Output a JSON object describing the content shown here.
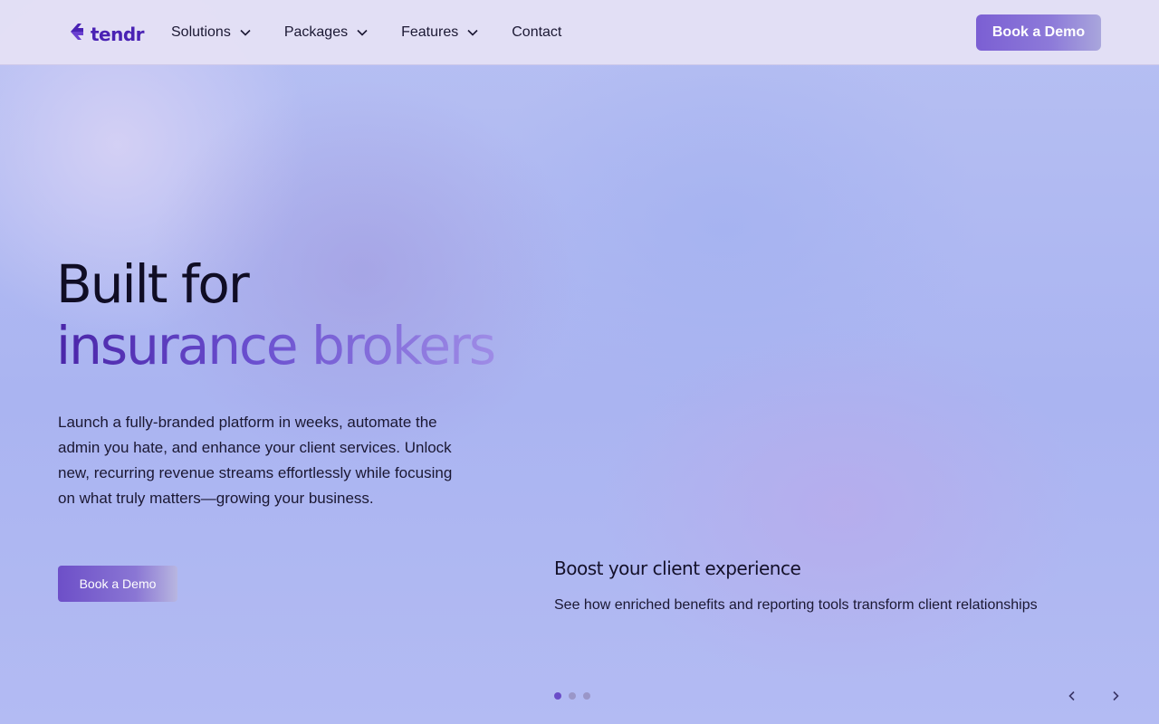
{
  "header": {
    "logo_text": "tendr",
    "nav": [
      {
        "label": "Solutions",
        "has_dropdown": true
      },
      {
        "label": "Packages",
        "has_dropdown": true
      },
      {
        "label": "Features",
        "has_dropdown": true
      },
      {
        "label": "Contact",
        "has_dropdown": false
      }
    ],
    "cta_label": "Book a Demo"
  },
  "hero": {
    "title_line1": "Built for",
    "title_line2": "insurance brokers",
    "description": "Launch a fully-branded platform in weeks, automate the admin you hate, and enhance your client services. Unlock new, recurring revenue streams effortlessly while focusing on what truly matters—growing your business.",
    "cta_label": "Book a Demo"
  },
  "carousel": {
    "slide_title": "Boost your client experience",
    "slide_description": "See how enriched benefits and reporting tools transform client relationships",
    "total_slides": 3,
    "active_slide": 1
  },
  "icons": {
    "logo": "tendr-logo-icon",
    "dropdown": "chevron-down-icon",
    "prev": "chevron-left-icon",
    "next": "chevron-right-icon"
  },
  "colors": {
    "brand": "#4a22b4",
    "accent": "#7b5fd3",
    "dot_active": "#6a4cc8",
    "dot_inactive": "#9a96c8"
  }
}
